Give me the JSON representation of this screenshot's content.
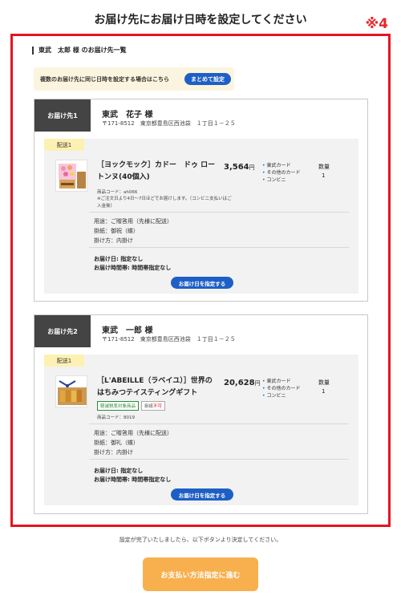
{
  "page": {
    "title": "お届け先にお届け日時を設定してください",
    "note_mark": "※4"
  },
  "section": {
    "heading": "東武　太郎 様 のお届け先一覧"
  },
  "bulk": {
    "text": "複数のお届け先に同じ日時を設定する場合はこちら",
    "button_label": "まとめて設定"
  },
  "destinations": [
    {
      "label": "お届け先1",
      "name": "東武　花子 様",
      "address": "〒171-8512　東京都豊島区西池袋　１丁目１－２５",
      "shipment_label": "配送1",
      "product_name": "［ヨックモック］カドー　ドゥ ロートンヌ(40個入)",
      "price": "3,564",
      "currency_suffix": "円",
      "payment_methods": [
        "東武カード",
        "その他のカード",
        "コンビニ"
      ],
      "qty_label": "数量",
      "qty": "1",
      "product_code": "商品コード：ah066",
      "note": "※ご注文日より4日〜7日ほどでお届けします。（コンビニ支払いはご入金後）",
      "details": [
        "用途：ご贈答用（先様に配送）",
        "掛紙：御祝（蝶）",
        "掛け方：内掛け"
      ],
      "delivery_date": "お届け日: 指定なし",
      "delivery_time": "お届け時間帯: 時間帯指定なし",
      "date_button": "お届け日を指定する"
    },
    {
      "label": "お届け先2",
      "name": "東武　一郎 様",
      "address": "〒171-8512　東京都豊島区西池袋　１丁目１－２５",
      "shipment_label": "配送1",
      "product_name": "［L'ABEILLE（ラベイユ）］世界のはちみつテイスティングギフト",
      "price": "20,628",
      "currency_suffix": "円",
      "payment_methods": [
        "東武カード",
        "その他のカード",
        "コンビニ"
      ],
      "qty_label": "数量",
      "qty": "1",
      "tag_reduced": "軽減税率対象商品",
      "tag_wrap_prefix": "掛紙",
      "tag_wrap_status": "不可",
      "product_code": "商品コード：8019",
      "details": [
        "用途：ご贈答用（先様に配送）",
        "掛紙：御礼（蝶）",
        "掛け方：内掛け"
      ],
      "delivery_date": "お届け日: 指定なし",
      "delivery_time": "お届け時間帯: 時間帯指定なし",
      "date_button": "お届け日を指定する"
    }
  ],
  "footer": {
    "note": "設定が完了いたしましたら、以下ボタンより決定してください。",
    "pay_button": "お支払い方法指定に進む"
  },
  "colors": {
    "frame_red": "#e4151f",
    "button_blue": "#1e5fc6",
    "pay_orange": "#f8b04e",
    "highlight_yellow": "#fbf5df"
  }
}
